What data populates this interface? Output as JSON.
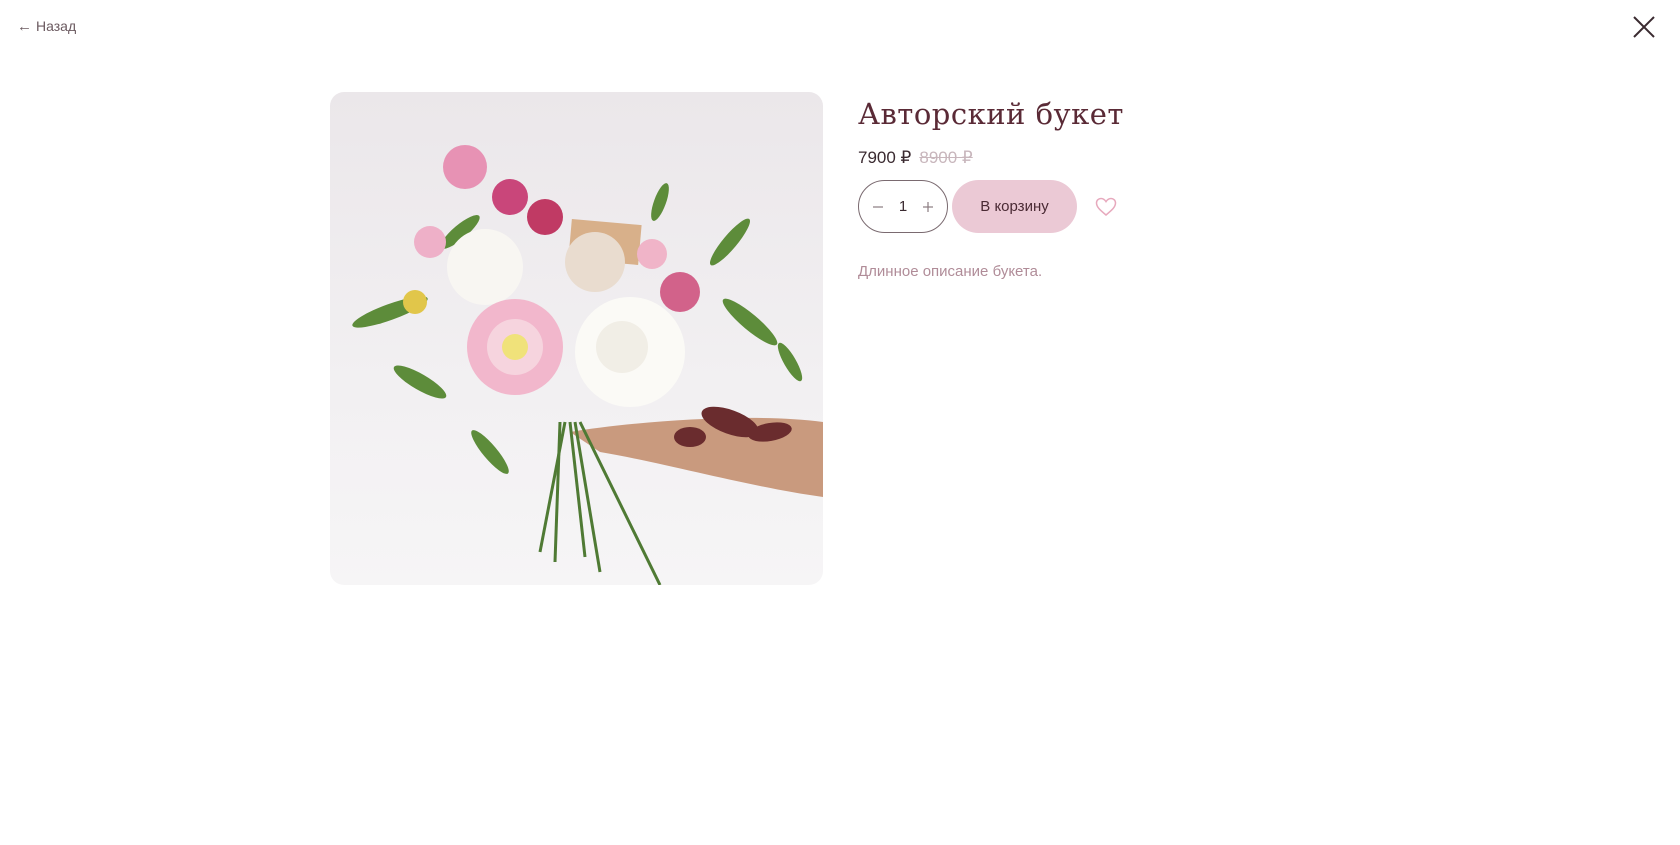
{
  "nav": {
    "back_arrow": "←",
    "back_label": "Назад"
  },
  "icons": {
    "close": "close-icon",
    "favorite": "heart-icon",
    "minus": "minus-icon",
    "plus": "plus-icon"
  },
  "product": {
    "title": "Авторский букет",
    "price_current": "7900 ₽",
    "price_old": "8900 ₽",
    "quantity": "1",
    "add_to_cart_label": "В корзину",
    "description": "Длинное описание букета."
  },
  "colors": {
    "title": "#5a2a36",
    "cart_button": "#ebc9d5",
    "heart": "#e7a9bd",
    "description": "#b08c98",
    "old_price": "#c8b6bc"
  }
}
